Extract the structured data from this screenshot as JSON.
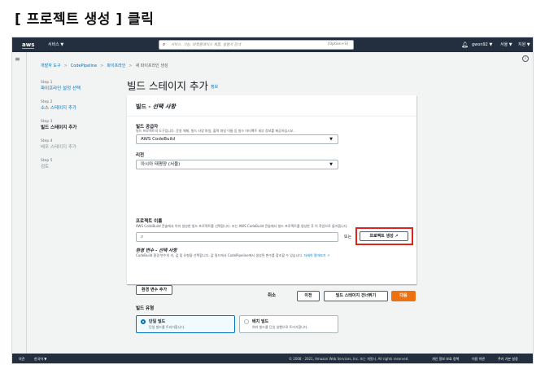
{
  "slide_title": "[ 프로젝트 생성 ] 클릭",
  "topnav": {
    "logo": "aws",
    "services": "서비스 ▼",
    "search_placeholder": "서비스, 기능, 마켓플레이스 제품, 설명서 검색",
    "search_shortcut": "[Option+S]",
    "user": "gwon92 ▼",
    "region": "서울 ▼",
    "support": "지원 ▼"
  },
  "breadcrumb": {
    "item1": "개발자 도구",
    "item2": "CodePipeline",
    "item3": "파이프라인",
    "item4": "새 파이프라인 생성"
  },
  "steps": [
    {
      "num": "Step 1",
      "label": "파이프라인 설정 선택"
    },
    {
      "num": "Step 2",
      "label": "소스 스테이지 추가"
    },
    {
      "num": "Step 3",
      "label": "빌드 스테이지 추가"
    },
    {
      "num": "Step 4",
      "label": "배포 스테이지 추가"
    },
    {
      "num": "Step 5",
      "label": "검토"
    }
  ],
  "page": {
    "heading": "빌드 스테이지 추가",
    "info": "정보"
  },
  "panel": {
    "header_prefix": "빌드 - ",
    "header_em": "선택 사항",
    "provider_label": "빌드 공급자",
    "provider_desc": "빌드 프로젝트의 도구입니다. 운영 체제, 빌드 사양 파일, 출력 파일 이름 등 빌드 아티팩트 세부 정보를 제공하십시오.",
    "provider_value": "AWS CodeBuild",
    "region_label": "리전",
    "region_value": "아시아 태평양 (서울)",
    "project_label": "프로젝트 이름",
    "project_desc": "AWS CodeBuild 콘솔에서 이미 생성한 빌드 프로젝트를 선택합니다. 또는 AWS CodeBuild 콘솔에서 빌드 프로젝트를 생성한 후 이 작업으로 돌아옵니다.",
    "or": "또는",
    "create_project": "프로젝트 생성 ↗",
    "env_label": "환경 변수 - 선택 사항",
    "env_desc": "CodeBuild 환경 변수의 키, 값 및 유형을 선택합니다. 값 필드에서 CodePipeline에서 생성된 변수를 참조할 수 있습니다.",
    "env_link": "자세히 알아보기 ↗",
    "env_button": "환경 변수 추가",
    "build_type_label": "빌드 유형",
    "single_title": "단일 빌드",
    "single_desc": "단일 빌드를 트리거합니다.",
    "batch_title": "배치 빌드",
    "batch_desc": "여러 빌드를 단일 실행으로 트리거합니다."
  },
  "actions": {
    "cancel": "취소",
    "prev": "이전",
    "skip": "빌드 스테이지 건너뛰기",
    "next": "다음"
  },
  "footer": {
    "feedback": "의견",
    "lang": "한국어 ▼",
    "copyright": "© 2008 - 2021, Amazon Web Services, Inc. 또는 계열사. All rights reserved.",
    "privacy": "개인 정보 보호 정책",
    "terms": "이용 약관",
    "cookie": "쿠키 기본 설정"
  },
  "colors": {
    "nav_bg": "#232f3e",
    "link": "#0073bb",
    "primary_button": "#ec7211",
    "highlight": "#e0241c"
  }
}
